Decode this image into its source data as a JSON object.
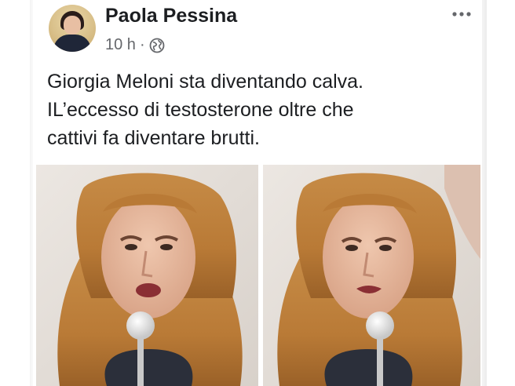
{
  "post": {
    "author_name": "Paola Pessina",
    "time": "10 h",
    "separator": "·",
    "audience_icon": "globe-icon",
    "more_icon": "ellipsis-icon",
    "text_lines": [
      "Giorgia Meloni sta diventando calva.",
      "IL’eccesso di testosterone oltre che",
      "cattivi fa diventare brutti."
    ]
  },
  "colors": {
    "text_primary": "#1c1e21",
    "text_secondary": "#65676b",
    "hair": "#c58a3e",
    "jacket": "#2b2f3a"
  }
}
